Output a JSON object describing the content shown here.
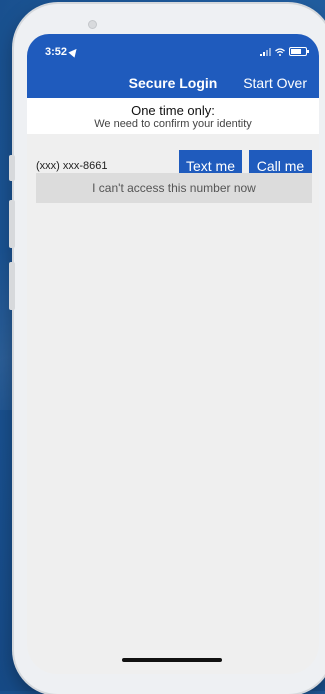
{
  "status_bar": {
    "time": "3:52",
    "location_icon": "location-arrow-icon",
    "signal_icon": "signal-icon",
    "wifi_icon": "wifi-icon",
    "battery_icon": "battery-icon"
  },
  "nav": {
    "title": "Secure Login",
    "start_over_label": "Start Over"
  },
  "banner": {
    "title": "One time only:",
    "subtitle": "We need to confirm your identity"
  },
  "contact": {
    "phone_number": "(xxx) xxx-8661",
    "text_label": "Text me",
    "call_label": "Call me"
  },
  "alternate": {
    "label": "I can't access this number now"
  },
  "colors": {
    "brand_blue": "#1f5bbd",
    "screen_bg": "#efefef",
    "secondary_button_bg": "#dcdcdc"
  }
}
